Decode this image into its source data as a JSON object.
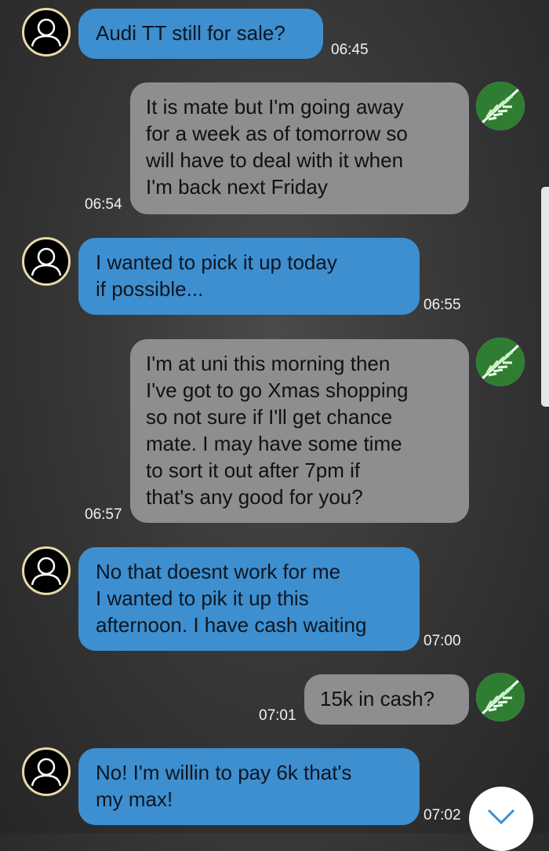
{
  "conversation": {
    "messages": [
      {
        "sender": "buyer",
        "text": "Audi TT still for sale?",
        "time": "06:45"
      },
      {
        "sender": "seller",
        "text": "It is mate but I'm going away\nfor a week as of tomorrow so\nwill have to deal with it when\nI'm back next Friday",
        "time": "06:54"
      },
      {
        "sender": "buyer",
        "text": "I wanted to pick it up today\nif possible...",
        "time": "06:55"
      },
      {
        "sender": "seller",
        "text": "I'm at uni this morning then\nI've got to go Xmas shopping\nso not sure if I'll get chance\nmate. I may have some time\nto sort it out after 7pm if\nthat's any good for you?",
        "time": "06:57"
      },
      {
        "sender": "buyer",
        "text": "No that doesnt work for me\nI wanted to pik it up this\nafternoon. I have cash waiting",
        "time": "07:00"
      },
      {
        "sender": "seller",
        "text": "15k in cash?",
        "time": "07:01"
      },
      {
        "sender": "buyer",
        "text": "No! I'm willin to pay 6k that's\nmy max!",
        "time": "07:02"
      }
    ]
  },
  "icons": {
    "buyer_avatar": "person-silhouette-icon",
    "seller_avatar": "fern-leaf-icon",
    "scroll_down": "chevron-down-icon"
  },
  "colors": {
    "buyer_bubble": "#3d8fd0",
    "seller_bubble": "#8e8e8e",
    "background": "#383838"
  }
}
